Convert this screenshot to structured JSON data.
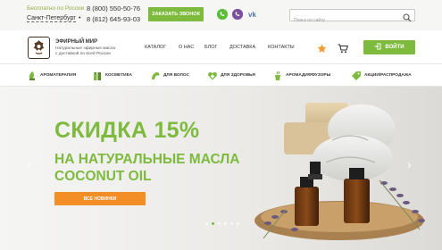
{
  "topbar": {
    "free_label": "Бесплатно по России",
    "phone1": "8 (800) 550-50-76",
    "city": "Санкт-Петербург",
    "bullet": "•",
    "phone2": "8 (812) 645-93-03",
    "callback_label": "ЗАКАЗАТЬ ЗВОНОК",
    "social": [
      {
        "icon": "whatsapp-icon",
        "glyph": "✆"
      },
      {
        "icon": "viber-icon",
        "glyph": "✆"
      },
      {
        "icon": "vk-icon",
        "glyph": "vk"
      }
    ],
    "search_placeholder": "Поиск по сайту"
  },
  "header": {
    "logo_title": "ЭФИРНЫЙ МИР",
    "logo_sub1": "Натуральные эфирные масла",
    "logo_sub2": "с доставкой по всей России",
    "nav": [
      "КАТАЛОГ",
      "О НАС",
      "БЛОГ",
      "ДОСТАВКА",
      "КОНТАКТЫ"
    ],
    "login_label": "ВОЙТИ"
  },
  "categories": [
    {
      "label": "АРОМАТЕРАПИЯ",
      "icon": "aromatherapy-icon"
    },
    {
      "label": "КОСМЕТИКА",
      "icon": "cosmetics-icon"
    },
    {
      "label": "ДЛЯ ВОЛОС",
      "icon": "hair-icon"
    },
    {
      "label": "ДЛЯ ЗДОРОВЬЯ",
      "icon": "health-icon"
    },
    {
      "label": "АРОМАДИФФУЗОРЫ",
      "icon": "diffuser-icon"
    },
    {
      "label": "АКЦИИ/РАСПРОДАЖА",
      "icon": "sale-icon"
    }
  ],
  "hero": {
    "title1": "СКИДКА 15%",
    "title2": "НА НАТУРАЛЬНЫЕ МАСЛА",
    "title3": "COCONUT OIL",
    "button_label": "ВСЕ НОВИНКИ",
    "prev_glyph": "‹",
    "next_glyph": "›",
    "slide_count": 6,
    "active_slide": 1
  },
  "colors": {
    "accent": "#7dba3e",
    "orange": "#f38d26",
    "star": "#f39a2e"
  }
}
